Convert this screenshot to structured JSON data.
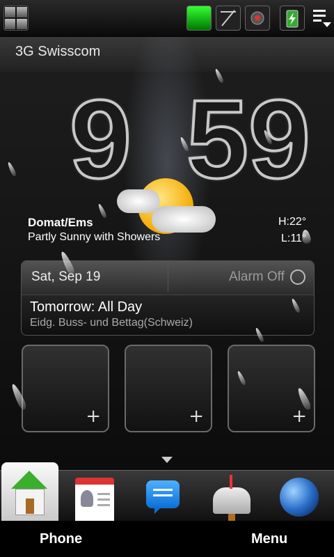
{
  "status_bar": {
    "icons": [
      "windows-start-icon",
      "signal-strength-icon",
      "no-data-icon",
      "camera-icon",
      "battery-charging-icon",
      "menu-indicator-icon"
    ]
  },
  "operator": "3G Swisscom",
  "clock": {
    "hour": "9",
    "minute": "59"
  },
  "weather": {
    "city": "Domat/Ems",
    "condition": "Partly Sunny with Showers",
    "high": "H:22°",
    "low": "L:11°",
    "icon": "partly-sunny-cloud-icon"
  },
  "calendar": {
    "date": "Sat, Sep 19",
    "alarm": "Alarm Off",
    "event_title": "Tomorrow: All Day",
    "event_subtitle": "Eidg. Buss- und Bettag(Schweiz)"
  },
  "shortcuts": {
    "add_symbol": "+"
  },
  "dock": {
    "items": [
      "home-icon",
      "contacts-icon",
      "messages-icon",
      "mail-icon",
      "internet-globe-icon"
    ]
  },
  "softkeys": {
    "left": "Phone",
    "right": "Menu"
  },
  "colors": {
    "accent_green": "#3cae2e",
    "messages_blue": "#0b6fd6"
  }
}
